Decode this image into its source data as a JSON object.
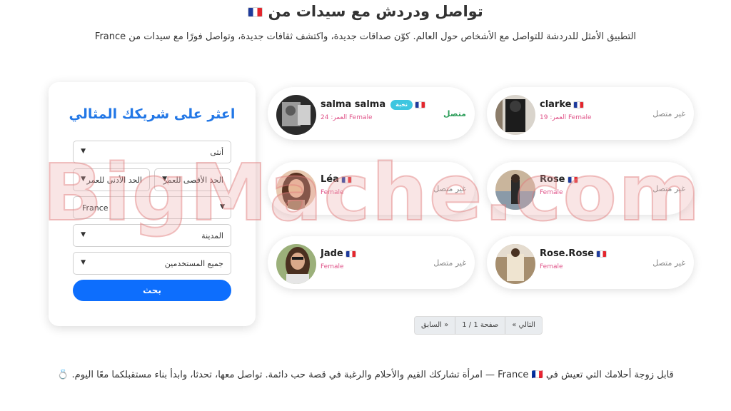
{
  "header": {
    "title": "تواصل ودردش مع سيدات من",
    "subtitle": "التطبيق الأمثل للدردشة للتواصل مع الأشخاص حول العالم. كوّن صداقات جديدة، واكتشف ثقافات جديدة، وتواصل فورًا مع سيدات من France"
  },
  "search": {
    "title": "اعثر على شريكك المثالي",
    "gender": "أنثى",
    "min_age": "الحد الأدنى للعمر",
    "max_age": "الحد الأقصى للعمر",
    "country": "France",
    "city": "المدينة",
    "users": "جميع المستخدمين",
    "button": "بحث"
  },
  "profiles": [
    {
      "name": "salma salma",
      "badge": "نخبة",
      "meta": "العمر: 24 Female",
      "status": "متصل",
      "online": true
    },
    {
      "name": "clarke",
      "badge": "",
      "meta": "العمر: 19 Female",
      "status": "غير متصل",
      "online": false
    },
    {
      "name": "Léa",
      "badge": "",
      "meta": "Female",
      "status": "غير متصل",
      "online": false
    },
    {
      "name": "Rose",
      "badge": "",
      "meta": "Female",
      "status": "غير متصل",
      "online": false
    },
    {
      "name": "Jade",
      "badge": "",
      "meta": "Female",
      "status": "غير متصل",
      "online": false
    },
    {
      "name": "Rose.Rose",
      "badge": "",
      "meta": "Female",
      "status": "غير متصل",
      "online": false
    }
  ],
  "pagination": {
    "next": "« التالي",
    "page": "صفحة 1 / 1",
    "prev": "السابق »"
  },
  "footer": {
    "text": "قابل زوجة أحلامك التي تعيش في France 🇫🇷 — امرأة تشاركك القيم والأحلام والرغبة في قصة حب دائمة. تواصل معها، تحدثا، وابدأ بناء مستقبلكما معًا اليوم. 💍"
  },
  "watermark": "BigMache.com",
  "colors": {
    "accent": "#0d6efd",
    "title_blue": "#2277e6",
    "online": "#2e9e5b",
    "female_pink": "#e0558a",
    "badge": "#3ec6e0"
  },
  "icons": {
    "flag": "france-flag-icon",
    "chevron": "chevron-down-icon"
  }
}
